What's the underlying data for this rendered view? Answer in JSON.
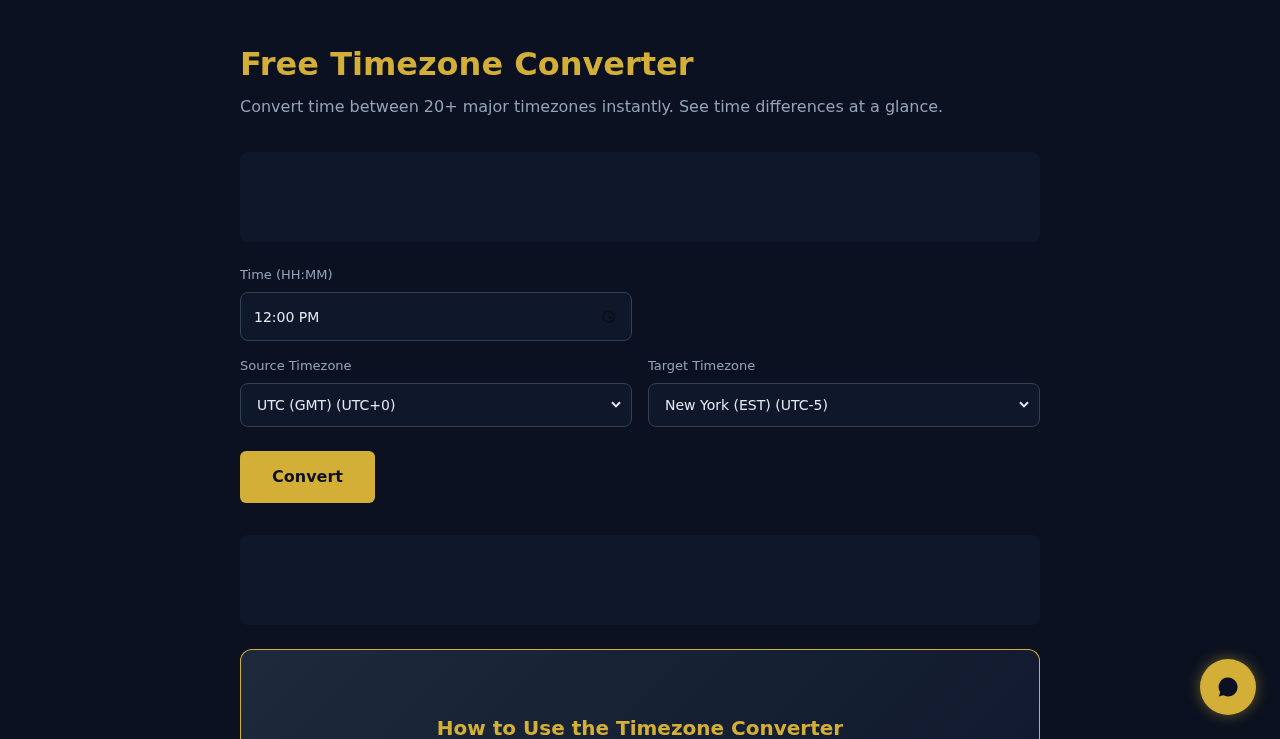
{
  "header": {
    "title": "Free Timezone Converter",
    "subtitle": "Convert time between 20+ major timezones instantly. See time differences at a glance."
  },
  "form": {
    "time": {
      "label": "Time (HH:MM)",
      "value": "12:00 PM"
    },
    "selects": [
      {
        "label": "Source Timezone",
        "value": "UTC (GMT) (UTC+0)"
      },
      {
        "label": "Target Timezone",
        "value": "New York (EST) (UTC-5)"
      }
    ],
    "button": "Convert"
  },
  "guide": {
    "title": "How to Use the Timezone Converter"
  }
}
